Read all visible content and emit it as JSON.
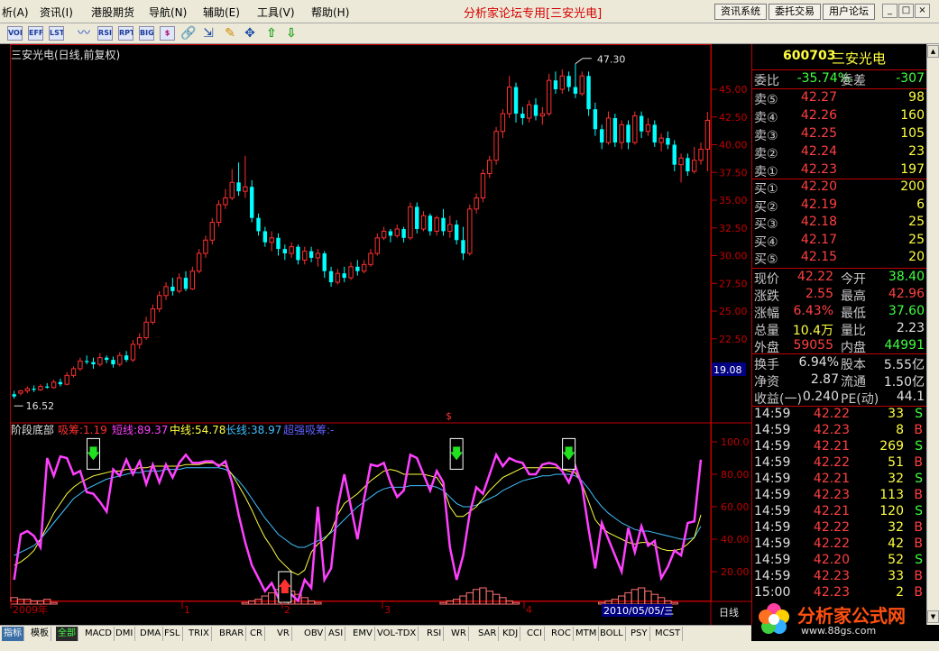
{
  "menu": {
    "items": [
      "析(A)",
      "资讯(I)",
      "港股期货",
      "导航(N)",
      "辅助(E)",
      "工具(V)",
      "帮助(H)"
    ]
  },
  "title": "分析家论坛专用[三安光电]",
  "top_buttons": [
    "资讯系统",
    "委托交易",
    "用户论坛"
  ],
  "window_buttons": [
    "_",
    "□",
    "×"
  ],
  "toolbar": {
    "text_buttons": [
      "VOL",
      "EFF",
      "LST",
      "RSI",
      "RPT",
      "BIG",
      "$"
    ]
  },
  "chart": {
    "header": "三安光电(日线,前复权)",
    "high_label": "47.30",
    "low_label": "16.52",
    "cursor_price": "19.08",
    "price_axis": [
      "45.00",
      "42.50",
      "40.00",
      "37.50",
      "35.00",
      "32.50",
      "30.00",
      "27.50",
      "25.00",
      "22.50"
    ],
    "osc_axis": [
      "100.0",
      "80.00",
      "60.00",
      "40.00",
      "20.00"
    ],
    "date_marks": [
      "2009年",
      "1",
      "2",
      "3",
      "4"
    ],
    "cursor_date": "2010/05/05/三",
    "period": "日线",
    "colors": {
      "up": "#ff3030",
      "down": "#00ffff",
      "bg": "#000000",
      "frame": "#c00000"
    }
  },
  "indicator": {
    "name": "阶段底部",
    "xishou": "吸筹:1.19",
    "short": "短线:89.37",
    "mid": "中线:54.78",
    "long": "长线:38.97",
    "super": "超强吸筹:-"
  },
  "quote": {
    "code": "600703",
    "name": "三安光电",
    "weibi_label": "委比",
    "weibi": "-35.74%",
    "weicha_label": "委差",
    "weicha": "-307",
    "asks": [
      {
        "label": "卖⑤",
        "price": "42.27",
        "vol": "98"
      },
      {
        "label": "卖④",
        "price": "42.26",
        "vol": "160"
      },
      {
        "label": "卖③",
        "price": "42.25",
        "vol": "105"
      },
      {
        "label": "卖②",
        "price": "42.24",
        "vol": "23"
      },
      {
        "label": "卖①",
        "price": "42.23",
        "vol": "197"
      }
    ],
    "bids": [
      {
        "label": "买①",
        "price": "42.20",
        "vol": "200"
      },
      {
        "label": "买②",
        "price": "42.19",
        "vol": "6"
      },
      {
        "label": "买③",
        "price": "42.18",
        "vol": "25"
      },
      {
        "label": "买④",
        "price": "42.17",
        "vol": "25"
      },
      {
        "label": "买⑤",
        "price": "42.15",
        "vol": "20"
      }
    ],
    "stats": [
      {
        "l1": "现价",
        "v1": "42.22",
        "c1": "#ff4040",
        "l2": "今开",
        "v2": "38.40",
        "c2": "#40ff40"
      },
      {
        "l1": "涨跌",
        "v1": "2.55",
        "c1": "#ff4040",
        "l2": "最高",
        "v2": "42.96",
        "c2": "#ff4040"
      },
      {
        "l1": "涨幅",
        "v1": "6.43%",
        "c1": "#ff4040",
        "l2": "最低",
        "v2": "37.60",
        "c2": "#40ff40"
      },
      {
        "l1": "总量",
        "v1": "10.4万",
        "c1": "#ffff40",
        "l2": "量比",
        "v2": "2.23",
        "c2": "#e0e0e0"
      },
      {
        "l1": "外盘",
        "v1": "59055",
        "c1": "#ff4040",
        "l2": "内盘",
        "v2": "44991",
        "c2": "#40ff40"
      }
    ],
    "stats2": [
      {
        "l1": "换手",
        "v1": "6.94%",
        "l2": "股本",
        "v2": "5.55亿"
      },
      {
        "l1": "净资",
        "v1": "2.87",
        "l2": "流通",
        "v2": "1.50亿"
      },
      {
        "l1": "收益(一)",
        "v1": "0.240",
        "l2": "PE(动)",
        "v2": "44.1"
      }
    ],
    "trades": [
      {
        "time": "14:59",
        "price": "42.22",
        "vol": "33",
        "bs": "S"
      },
      {
        "time": "14:59",
        "price": "42.23",
        "vol": "8",
        "bs": "B"
      },
      {
        "time": "14:59",
        "price": "42.21",
        "vol": "269",
        "bs": "S"
      },
      {
        "time": "14:59",
        "price": "42.22",
        "vol": "51",
        "bs": "B"
      },
      {
        "time": "14:59",
        "price": "42.21",
        "vol": "32",
        "bs": "S"
      },
      {
        "time": "14:59",
        "price": "42.23",
        "vol": "113",
        "bs": "B"
      },
      {
        "time": "14:59",
        "price": "42.21",
        "vol": "120",
        "bs": "S"
      },
      {
        "time": "14:59",
        "price": "42.22",
        "vol": "32",
        "bs": "B"
      },
      {
        "time": "14:59",
        "price": "42.22",
        "vol": "42",
        "bs": "B"
      },
      {
        "time": "14:59",
        "price": "42.20",
        "vol": "52",
        "bs": "S"
      },
      {
        "time": "14:59",
        "price": "42.23",
        "vol": "33",
        "bs": "B"
      },
      {
        "time": "15:00",
        "price": "42.23",
        "vol": "2",
        "bs": "B"
      }
    ]
  },
  "tabs": [
    "指标",
    "模板",
    "全部",
    "MACD",
    "DMI",
    "DMA",
    "FSL",
    "TRIX",
    "BRAR",
    "CR",
    "VR",
    "OBV",
    "ASI",
    "EMV",
    "VOL-TDX",
    "RSI",
    "WR",
    "SAR",
    "KDJ",
    "CCI",
    "ROC",
    "MTM",
    "BOLL",
    "PSY",
    "MCST"
  ],
  "logo": {
    "text": "分析家公式网",
    "url": "www.88gs.com"
  },
  "chart_data": {
    "type": "candlestick",
    "price_range": [
      16,
      49
    ],
    "candles": [
      [
        17.5,
        17.3,
        17.8,
        17.1
      ],
      [
        17.6,
        17.8,
        17.9,
        17.4
      ],
      [
        17.8,
        18.0,
        18.2,
        17.6
      ],
      [
        18.0,
        17.9,
        18.3,
        17.7
      ],
      [
        17.9,
        18.2,
        18.4,
        17.8
      ],
      [
        18.2,
        18.1,
        18.5,
        18.0
      ],
      [
        18.1,
        18.6,
        18.8,
        18.0
      ],
      [
        18.6,
        18.4,
        18.9,
        18.2
      ],
      [
        18.4,
        19.2,
        19.5,
        18.3
      ],
      [
        19.2,
        19.8,
        20.0,
        19.0
      ],
      [
        19.8,
        20.5,
        20.8,
        19.6
      ],
      [
        20.5,
        20.4,
        21.0,
        20.2
      ],
      [
        20.4,
        20.2,
        20.8,
        19.8
      ],
      [
        20.2,
        20.8,
        21.2,
        20.0
      ],
      [
        20.8,
        20.6,
        21.0,
        20.3
      ],
      [
        20.6,
        20.2,
        20.9,
        19.9
      ],
      [
        20.2,
        21.0,
        21.3,
        20.0
      ],
      [
        21.0,
        20.6,
        21.4,
        20.4
      ],
      [
        20.6,
        22.0,
        22.4,
        20.4
      ],
      [
        22.0,
        22.6,
        23.0,
        21.6
      ],
      [
        22.6,
        24.0,
        24.5,
        22.4
      ],
      [
        24.0,
        25.2,
        25.6,
        23.8
      ],
      [
        25.2,
        26.4,
        26.8,
        24.9
      ],
      [
        26.4,
        27.2,
        27.6,
        26.0
      ],
      [
        27.2,
        26.8,
        28.0,
        26.4
      ],
      [
        26.8,
        28.0,
        28.4,
        26.6
      ],
      [
        28.0,
        27.0,
        28.6,
        26.8
      ],
      [
        27.0,
        28.6,
        29.0,
        26.9
      ],
      [
        28.6,
        30.2,
        30.6,
        28.4
      ],
      [
        30.2,
        31.4,
        31.8,
        29.8
      ],
      [
        31.4,
        33.0,
        33.4,
        31.0
      ],
      [
        33.0,
        34.6,
        35.0,
        32.6
      ],
      [
        34.6,
        35.2,
        36.0,
        34.2
      ],
      [
        35.2,
        36.6,
        37.8,
        35.0
      ],
      [
        36.6,
        35.8,
        38.4,
        35.4
      ],
      [
        35.8,
        36.2,
        39.0,
        35.2
      ],
      [
        36.2,
        33.4,
        36.8,
        33.0
      ],
      [
        33.4,
        32.2,
        33.8,
        31.8
      ],
      [
        32.2,
        31.2,
        32.6,
        30.8
      ],
      [
        31.2,
        31.6,
        32.2,
        30.4
      ],
      [
        31.6,
        30.6,
        32.0,
        30.0
      ],
      [
        30.6,
        30.2,
        31.0,
        29.6
      ],
      [
        30.2,
        30.8,
        31.2,
        29.8
      ],
      [
        30.8,
        29.6,
        31.0,
        29.2
      ],
      [
        29.6,
        30.4,
        30.8,
        29.2
      ],
      [
        30.4,
        29.8,
        30.8,
        29.4
      ],
      [
        29.8,
        30.2,
        30.6,
        29.0
      ],
      [
        30.2,
        28.6,
        30.4,
        28.0
      ],
      [
        28.6,
        27.6,
        29.0,
        27.2
      ],
      [
        27.6,
        28.4,
        28.8,
        27.4
      ],
      [
        28.4,
        28.0,
        29.0,
        27.6
      ],
      [
        28.0,
        29.0,
        29.4,
        27.8
      ],
      [
        29.0,
        28.6,
        29.6,
        28.2
      ],
      [
        28.6,
        29.2,
        29.6,
        28.4
      ],
      [
        29.2,
        30.2,
        30.6,
        29.0
      ],
      [
        30.2,
        31.6,
        32.0,
        30.0
      ],
      [
        31.6,
        32.2,
        32.6,
        31.4
      ],
      [
        32.2,
        31.8,
        32.4,
        31.2
      ],
      [
        31.8,
        32.4,
        32.8,
        31.6
      ],
      [
        32.4,
        31.6,
        32.6,
        31.2
      ],
      [
        31.6,
        34.4,
        34.8,
        31.4
      ],
      [
        34.4,
        32.4,
        34.8,
        32.0
      ],
      [
        32.4,
        33.6,
        34.0,
        32.2
      ],
      [
        33.6,
        32.2,
        33.8,
        31.8
      ],
      [
        32.2,
        33.4,
        33.6,
        31.8
      ],
      [
        33.4,
        32.2,
        34.2,
        31.8
      ],
      [
        32.2,
        32.8,
        33.6,
        31.6
      ],
      [
        32.8,
        31.4,
        33.2,
        31.0
      ],
      [
        31.4,
        30.2,
        32.6,
        29.6
      ],
      [
        30.2,
        34.2,
        34.6,
        30.0
      ],
      [
        34.2,
        35.2,
        35.6,
        33.8
      ],
      [
        35.2,
        37.4,
        37.8,
        34.8
      ],
      [
        37.4,
        38.6,
        39.0,
        37.0
      ],
      [
        38.6,
        41.2,
        41.6,
        38.2
      ],
      [
        41.2,
        42.8,
        43.2,
        40.6
      ],
      [
        42.8,
        45.2,
        46.2,
        42.4
      ],
      [
        45.2,
        42.8,
        45.6,
        42.0
      ],
      [
        42.8,
        42.4,
        43.4,
        41.8
      ],
      [
        42.4,
        43.6,
        44.0,
        42.0
      ],
      [
        43.6,
        42.6,
        44.2,
        42.2
      ],
      [
        42.6,
        42.8,
        43.4,
        41.8
      ],
      [
        42.8,
        45.8,
        46.4,
        42.6
      ],
      [
        45.8,
        45.0,
        46.6,
        44.6
      ],
      [
        45.0,
        46.2,
        46.8,
        44.6
      ],
      [
        46.2,
        45.2,
        46.6,
        44.8
      ],
      [
        45.2,
        44.6,
        47.3,
        44.2
      ],
      [
        44.6,
        46.2,
        46.6,
        44.4
      ],
      [
        46.2,
        43.2,
        46.6,
        42.6
      ],
      [
        43.2,
        41.4,
        43.8,
        40.8
      ],
      [
        41.4,
        40.2,
        41.8,
        39.6
      ],
      [
        40.2,
        42.4,
        43.0,
        40.0
      ],
      [
        42.4,
        40.2,
        42.8,
        39.8
      ],
      [
        40.2,
        41.8,
        42.2,
        39.6
      ],
      [
        41.8,
        40.2,
        42.2,
        39.6
      ],
      [
        40.2,
        42.6,
        43.0,
        40.0
      ],
      [
        42.6,
        41.2,
        43.0,
        40.6
      ],
      [
        41.2,
        41.8,
        42.4,
        40.8
      ],
      [
        41.8,
        40.2,
        42.2,
        39.8
      ],
      [
        40.2,
        40.6,
        41.0,
        39.4
      ],
      [
        40.6,
        40.0,
        41.2,
        39.6
      ],
      [
        40.0,
        38.2,
        40.4,
        37.6
      ],
      [
        38.2,
        38.8,
        39.2,
        36.6
      ],
      [
        38.8,
        37.6,
        39.2,
        37.2
      ],
      [
        37.6,
        38.6,
        39.8,
        37.4
      ],
      [
        38.6,
        39.6,
        40.2,
        38.2
      ],
      [
        39.6,
        42.2,
        42.96,
        37.6
      ]
    ],
    "osc_short": [
      15,
      43,
      45,
      42,
      35,
      90,
      79,
      91,
      90,
      80,
      82,
      69,
      68,
      63,
      57,
      83,
      79,
      89,
      80,
      88,
      74,
      86,
      75,
      86,
      78,
      87,
      92,
      87,
      87,
      88,
      88,
      85,
      88,
      75,
      55,
      38,
      24,
      16,
      8,
      13,
      4,
      5,
      6,
      2,
      15,
      10,
      60,
      15,
      22,
      60,
      80,
      60,
      40,
      65,
      86,
      85,
      87,
      75,
      66,
      70,
      92,
      90,
      80,
      70,
      82,
      75,
      35,
      15,
      30,
      56,
      72,
      68,
      80,
      92,
      85,
      90,
      88,
      87,
      80,
      80,
      86,
      87,
      86,
      82,
      75,
      85,
      73,
      46,
      22,
      50,
      40,
      30,
      20,
      47,
      32,
      48,
      36,
      39,
      16,
      23,
      33,
      30,
      50,
      51,
      89
    ],
    "osc_mid": [
      24,
      26,
      29,
      33,
      40,
      48,
      56,
      62,
      68,
      72,
      75,
      77,
      79,
      80,
      81,
      82,
      82,
      83,
      83,
      84,
      84,
      85,
      85,
      85,
      85,
      85,
      86,
      86,
      86,
      87,
      87,
      86,
      85,
      80,
      73,
      66,
      58,
      49,
      41,
      35,
      28,
      24,
      20,
      18,
      21,
      32,
      37,
      40,
      45,
      55,
      62,
      65,
      68,
      72,
      76,
      79,
      82,
      83,
      82,
      80,
      80,
      80,
      80,
      79,
      78,
      72,
      60,
      54,
      54,
      57,
      60,
      65,
      70,
      74,
      78,
      80,
      82,
      84,
      84,
      84,
      84,
      84,
      84,
      83,
      82,
      81,
      74,
      63,
      52,
      47,
      44,
      42,
      40,
      38,
      37,
      38,
      38,
      36,
      34,
      33,
      33,
      34,
      37,
      41,
      55
    ],
    "osc_long": [
      30,
      32,
      34,
      36,
      40,
      45,
      50,
      55,
      60,
      65,
      68,
      71,
      73,
      75,
      77,
      78,
      79,
      80,
      81,
      81,
      82,
      82,
      82,
      83,
      83,
      83,
      84,
      84,
      84,
      84,
      84,
      84,
      83,
      80,
      76,
      71,
      65,
      59,
      53,
      48,
      43,
      40,
      37,
      35,
      35,
      37,
      39,
      41,
      44,
      48,
      52,
      56,
      60,
      63,
      66,
      69,
      71,
      72,
      72,
      72,
      73,
      73,
      73,
      73,
      72,
      70,
      66,
      62,
      60,
      60,
      61,
      63,
      65,
      67,
      70,
      72,
      74,
      76,
      77,
      78,
      79,
      79,
      80,
      80,
      80,
      79,
      76,
      71,
      65,
      60,
      56,
      53,
      50,
      48,
      46,
      45,
      45,
      44,
      43,
      42,
      41,
      40,
      40,
      41,
      48
    ],
    "volume_bars": [
      4,
      3,
      3,
      2,
      2,
      3,
      1,
      0,
      0,
      0,
      0,
      0,
      0,
      0,
      0,
      0,
      0,
      0,
      0,
      0,
      0,
      0,
      0,
      0,
      0,
      0,
      0,
      0,
      0,
      0,
      0,
      0,
      0,
      0,
      0,
      1,
      2,
      3,
      5,
      7,
      9,
      10,
      8,
      6,
      4,
      2,
      1,
      0,
      0,
      0,
      0,
      0,
      0,
      0,
      0,
      0,
      0,
      0,
      0,
      0,
      0,
      0,
      0,
      0,
      0,
      1,
      2,
      3,
      5,
      7,
      9,
      10,
      8,
      6,
      4,
      2,
      1,
      0,
      0,
      0,
      0,
      0,
      0,
      0,
      0,
      0,
      0,
      0,
      0,
      1,
      2,
      3,
      5,
      7,
      9,
      10,
      8,
      6,
      4,
      2,
      1,
      0,
      0,
      0,
      0
    ],
    "signals": [
      {
        "idx": 12,
        "dir": "down"
      },
      {
        "idx": 67,
        "dir": "down"
      },
      {
        "idx": 84,
        "dir": "down"
      },
      {
        "idx": 41,
        "dir": "up"
      }
    ]
  }
}
